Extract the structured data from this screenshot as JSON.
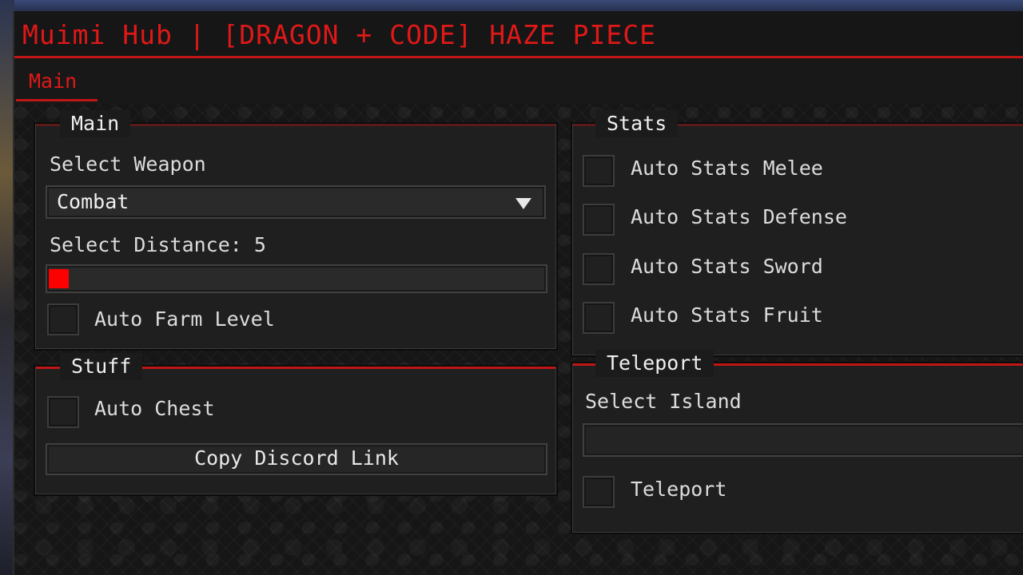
{
  "window": {
    "title": "Muimi Hub | [DRAGON + CODE] HAZE PIECE"
  },
  "tabs": [
    {
      "label": "Main"
    }
  ],
  "main_section": {
    "title": "Main",
    "weapon_label": "Select Weapon",
    "weapon_value": "Combat",
    "distance_label": "Select Distance:",
    "distance_value": "5",
    "distance_fill_fraction": 0.04,
    "auto_farm_label": "Auto Farm Level"
  },
  "stats_section": {
    "title": "Stats",
    "items": [
      {
        "label": "Auto Stats Melee"
      },
      {
        "label": "Auto Stats Defense"
      },
      {
        "label": "Auto Stats Sword"
      },
      {
        "label": "Auto Stats Fruit"
      }
    ]
  },
  "stuff_section": {
    "title": "Stuff",
    "auto_chest_label": "Auto Chest",
    "discord_button": "Copy Discord Link"
  },
  "teleport_section": {
    "title": "Teleport",
    "island_label": "Select Island",
    "island_value": "",
    "teleport_label": "Teleport"
  },
  "colors": {
    "accent": "#c01616",
    "title_text": "#e01818",
    "slider_fill": "#ff0000"
  }
}
